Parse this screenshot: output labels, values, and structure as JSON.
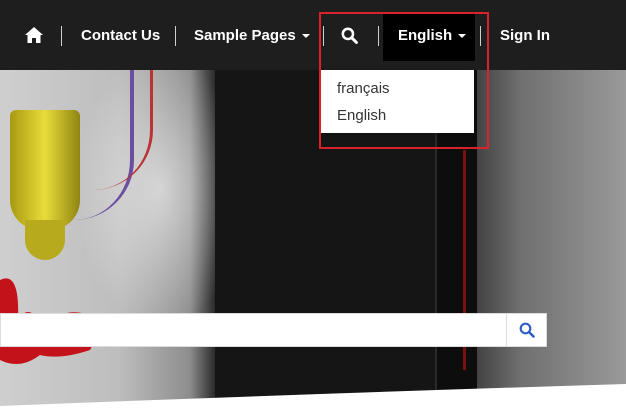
{
  "nav": {
    "contact_label": "Contact Us",
    "sample_pages_label": "Sample Pages",
    "language_label": "English",
    "signin_label": "Sign In"
  },
  "language_menu": {
    "options": [
      "français",
      "English"
    ]
  },
  "search": {
    "placeholder": ""
  },
  "colors": {
    "navbar_bg": "#1e1e1e",
    "highlight": "#d8232a",
    "search_icon": "#2f5fc4"
  },
  "icons": [
    "home-icon",
    "search-icon",
    "caret-down-icon",
    "search-submit-icon"
  ]
}
